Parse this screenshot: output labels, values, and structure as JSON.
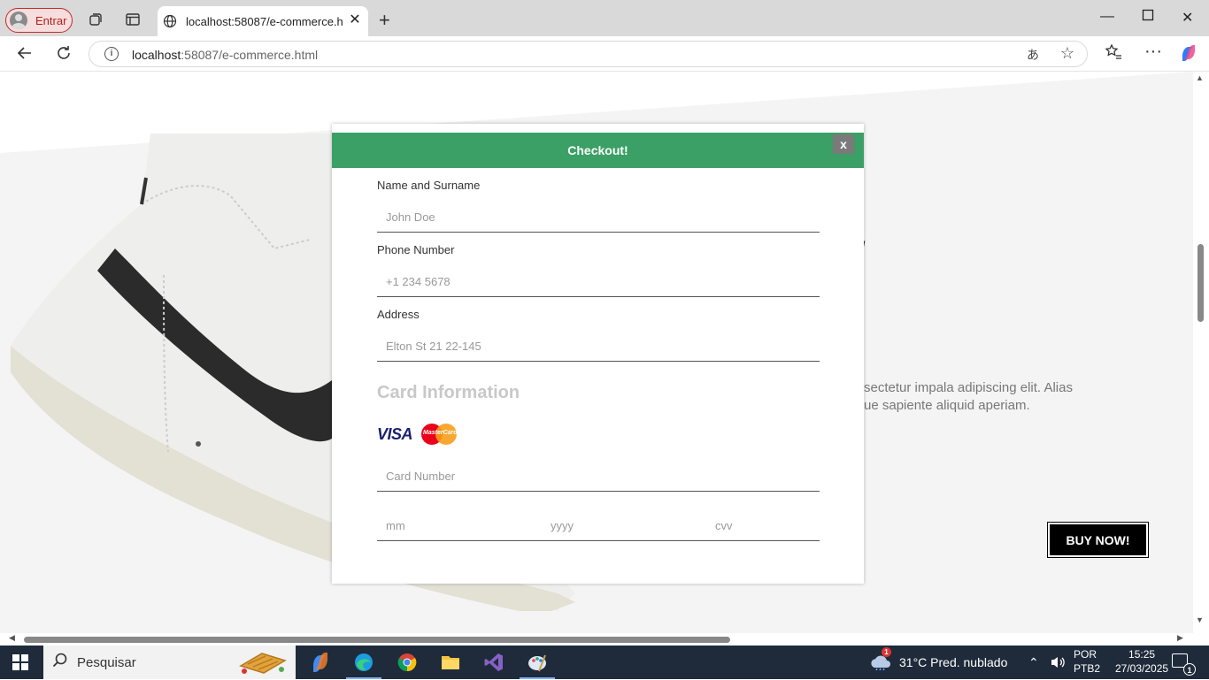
{
  "browser": {
    "profile_label": "Entrar",
    "tab_title": "localhost:58087/e-commerce.html",
    "url_host": "localhost",
    "url_rest": ":58087/e-commerce.html"
  },
  "page": {
    "side_text_line1": "sectetur impala adipiscing elit. Alias",
    "side_text_line2": "ue sapiente aliquid aperiam.",
    "buy_now": "BUY NOW!"
  },
  "checkout": {
    "title": "Checkout!",
    "close_label": "x",
    "name_label": "Name and Surname",
    "name_placeholder": "John Doe",
    "phone_label": "Phone Number",
    "phone_placeholder": "+1 234 5678",
    "address_label": "Address",
    "address_placeholder": "Elton St 21 22-145",
    "card_title": "Card Information",
    "visa": "VISA",
    "mastercard": "MasterCard",
    "card_number_placeholder": "Card Number",
    "mm_placeholder": "mm",
    "yyyy_placeholder": "yyyy",
    "cvv_placeholder": "cvv"
  },
  "taskbar": {
    "search_label": "Pesquisar",
    "weather": "31°C  Pred. nublado",
    "lang_line1": "POR",
    "lang_line2": "PTB2",
    "time": "15:25",
    "date": "27/03/2025",
    "notification_count": "1",
    "weather_badge": "1"
  }
}
